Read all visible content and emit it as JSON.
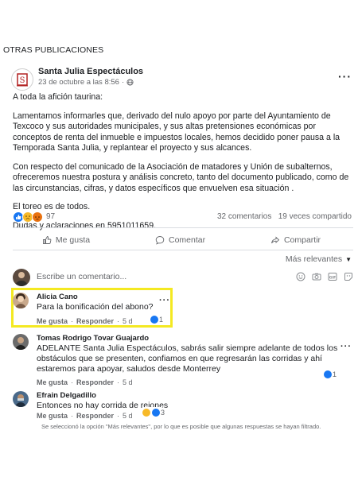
{
  "section_title": "OTRAS PUBLICACIONES",
  "post": {
    "page_name": "Santa Julia Espectáculos",
    "date": "23 de octubre a las 8:56",
    "paragraphs": [
      "A toda la afición taurina:",
      "Lamentamos informarles que, derivado del nulo apoyo por parte del Ayuntamiento de Texcoco y sus autoridades municipales, y sus altas pretensiones económicas por conceptos de renta del inmueble e impuestos locales, hemos decidido poner pausa a la Temporada Santa Julia, y replantear el proyecto y sus alcances.",
      "Con respecto del comunicado de la Asociación de matadores y Unión de subalternos, ofreceremos nuestra postura y análisis concreto, tanto del documento publicado, como de las circunstancias, cifras, y datos específicos que envuelven esa situación   .",
      "El toreo es de todos.",
      "Dudas y aclaraciones en 5951011659."
    ],
    "reaction_count": "97",
    "comments_count": "32 comentarios",
    "shares_count": "19 veces compartido"
  },
  "actions": {
    "like": "Me gusta",
    "comment": "Comentar",
    "share": "Compartir"
  },
  "sort_label": "Más relevantes",
  "compose_placeholder": "Escribe un comentario...",
  "comments": [
    {
      "name": "Alicia Cano",
      "text": "Para la bonificación del abono?",
      "like": "Me gusta",
      "reply": "Responder",
      "time": "5 d",
      "reactions": "1"
    },
    {
      "name": "Tomas Rodrigo Tovar Guajardo",
      "text": "ADELANTE Santa Julia Espectáculos, sabrás salir siempre adelante de todos los obstáculos que se presenten, confiamos en que regresarán las corridas y ahí estaremos para apoyar, saludos desde Monterrey",
      "like": "Me gusta",
      "reply": "Responder",
      "time": "5 d",
      "reactions": "1"
    },
    {
      "name": "Efrain Delgadillo",
      "text": "Entonces no hay corrida de rejones",
      "like": "Me gusta",
      "reply": "Responder",
      "time": "5 d",
      "reactions": "3"
    }
  ],
  "filter_note": "Se seleccionó la opción \"Más relevantes\", por lo que es posible que algunas respuestas se hayan filtrado.",
  "colors": {
    "like_blue": "#1877f2",
    "highlight_yellow": "#f4e922",
    "text_secondary": "#65676b"
  }
}
